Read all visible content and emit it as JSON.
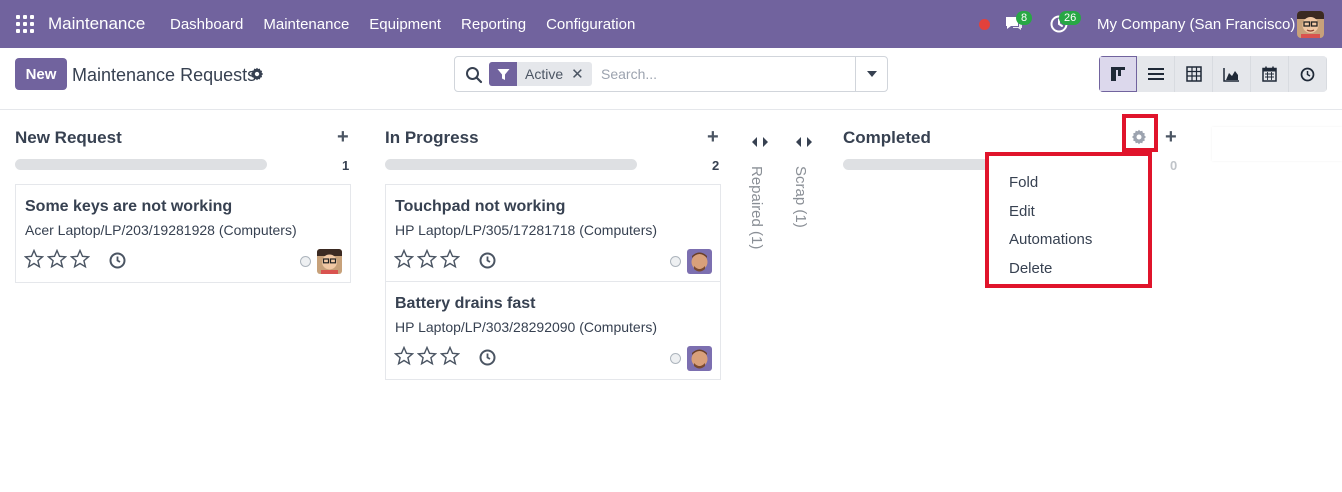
{
  "navbar": {
    "brand": "Maintenance",
    "menu": [
      "Dashboard",
      "Maintenance",
      "Equipment",
      "Reporting",
      "Configuration"
    ],
    "chat_count": "8",
    "activity_count": "26",
    "company": "My Company (San Francisco)"
  },
  "control_panel": {
    "new_label": "New",
    "title": "Maintenance Requests",
    "search": {
      "facet_label": "Active",
      "facet_close": "✕",
      "placeholder": "Search..."
    }
  },
  "kanban": {
    "columns": [
      {
        "title": "New Request",
        "count": "1",
        "cards": [
          {
            "title": "Some keys are not working",
            "equipment": "Acer Laptop/LP/203/19281928 (Computers)"
          }
        ]
      },
      {
        "title": "In Progress",
        "count": "2",
        "cards": [
          {
            "title": "Touchpad not working",
            "equipment": "HP Laptop/LP/305/17281718 (Computers)"
          },
          {
            "title": "Battery drains fast",
            "equipment": "HP Laptop/LP/303/28292090 (Computers)"
          }
        ]
      },
      {
        "title": "Repaired (1)",
        "folded": true
      },
      {
        "title": "Scrap (1)",
        "folded": true
      },
      {
        "title": "Completed",
        "count": "0",
        "cards": []
      }
    ],
    "column_menu": [
      "Fold",
      "Edit",
      "Automations",
      "Delete"
    ]
  },
  "colors": {
    "brand": "#71639e",
    "highlight": "#e0142b",
    "badge": "#28a745"
  }
}
